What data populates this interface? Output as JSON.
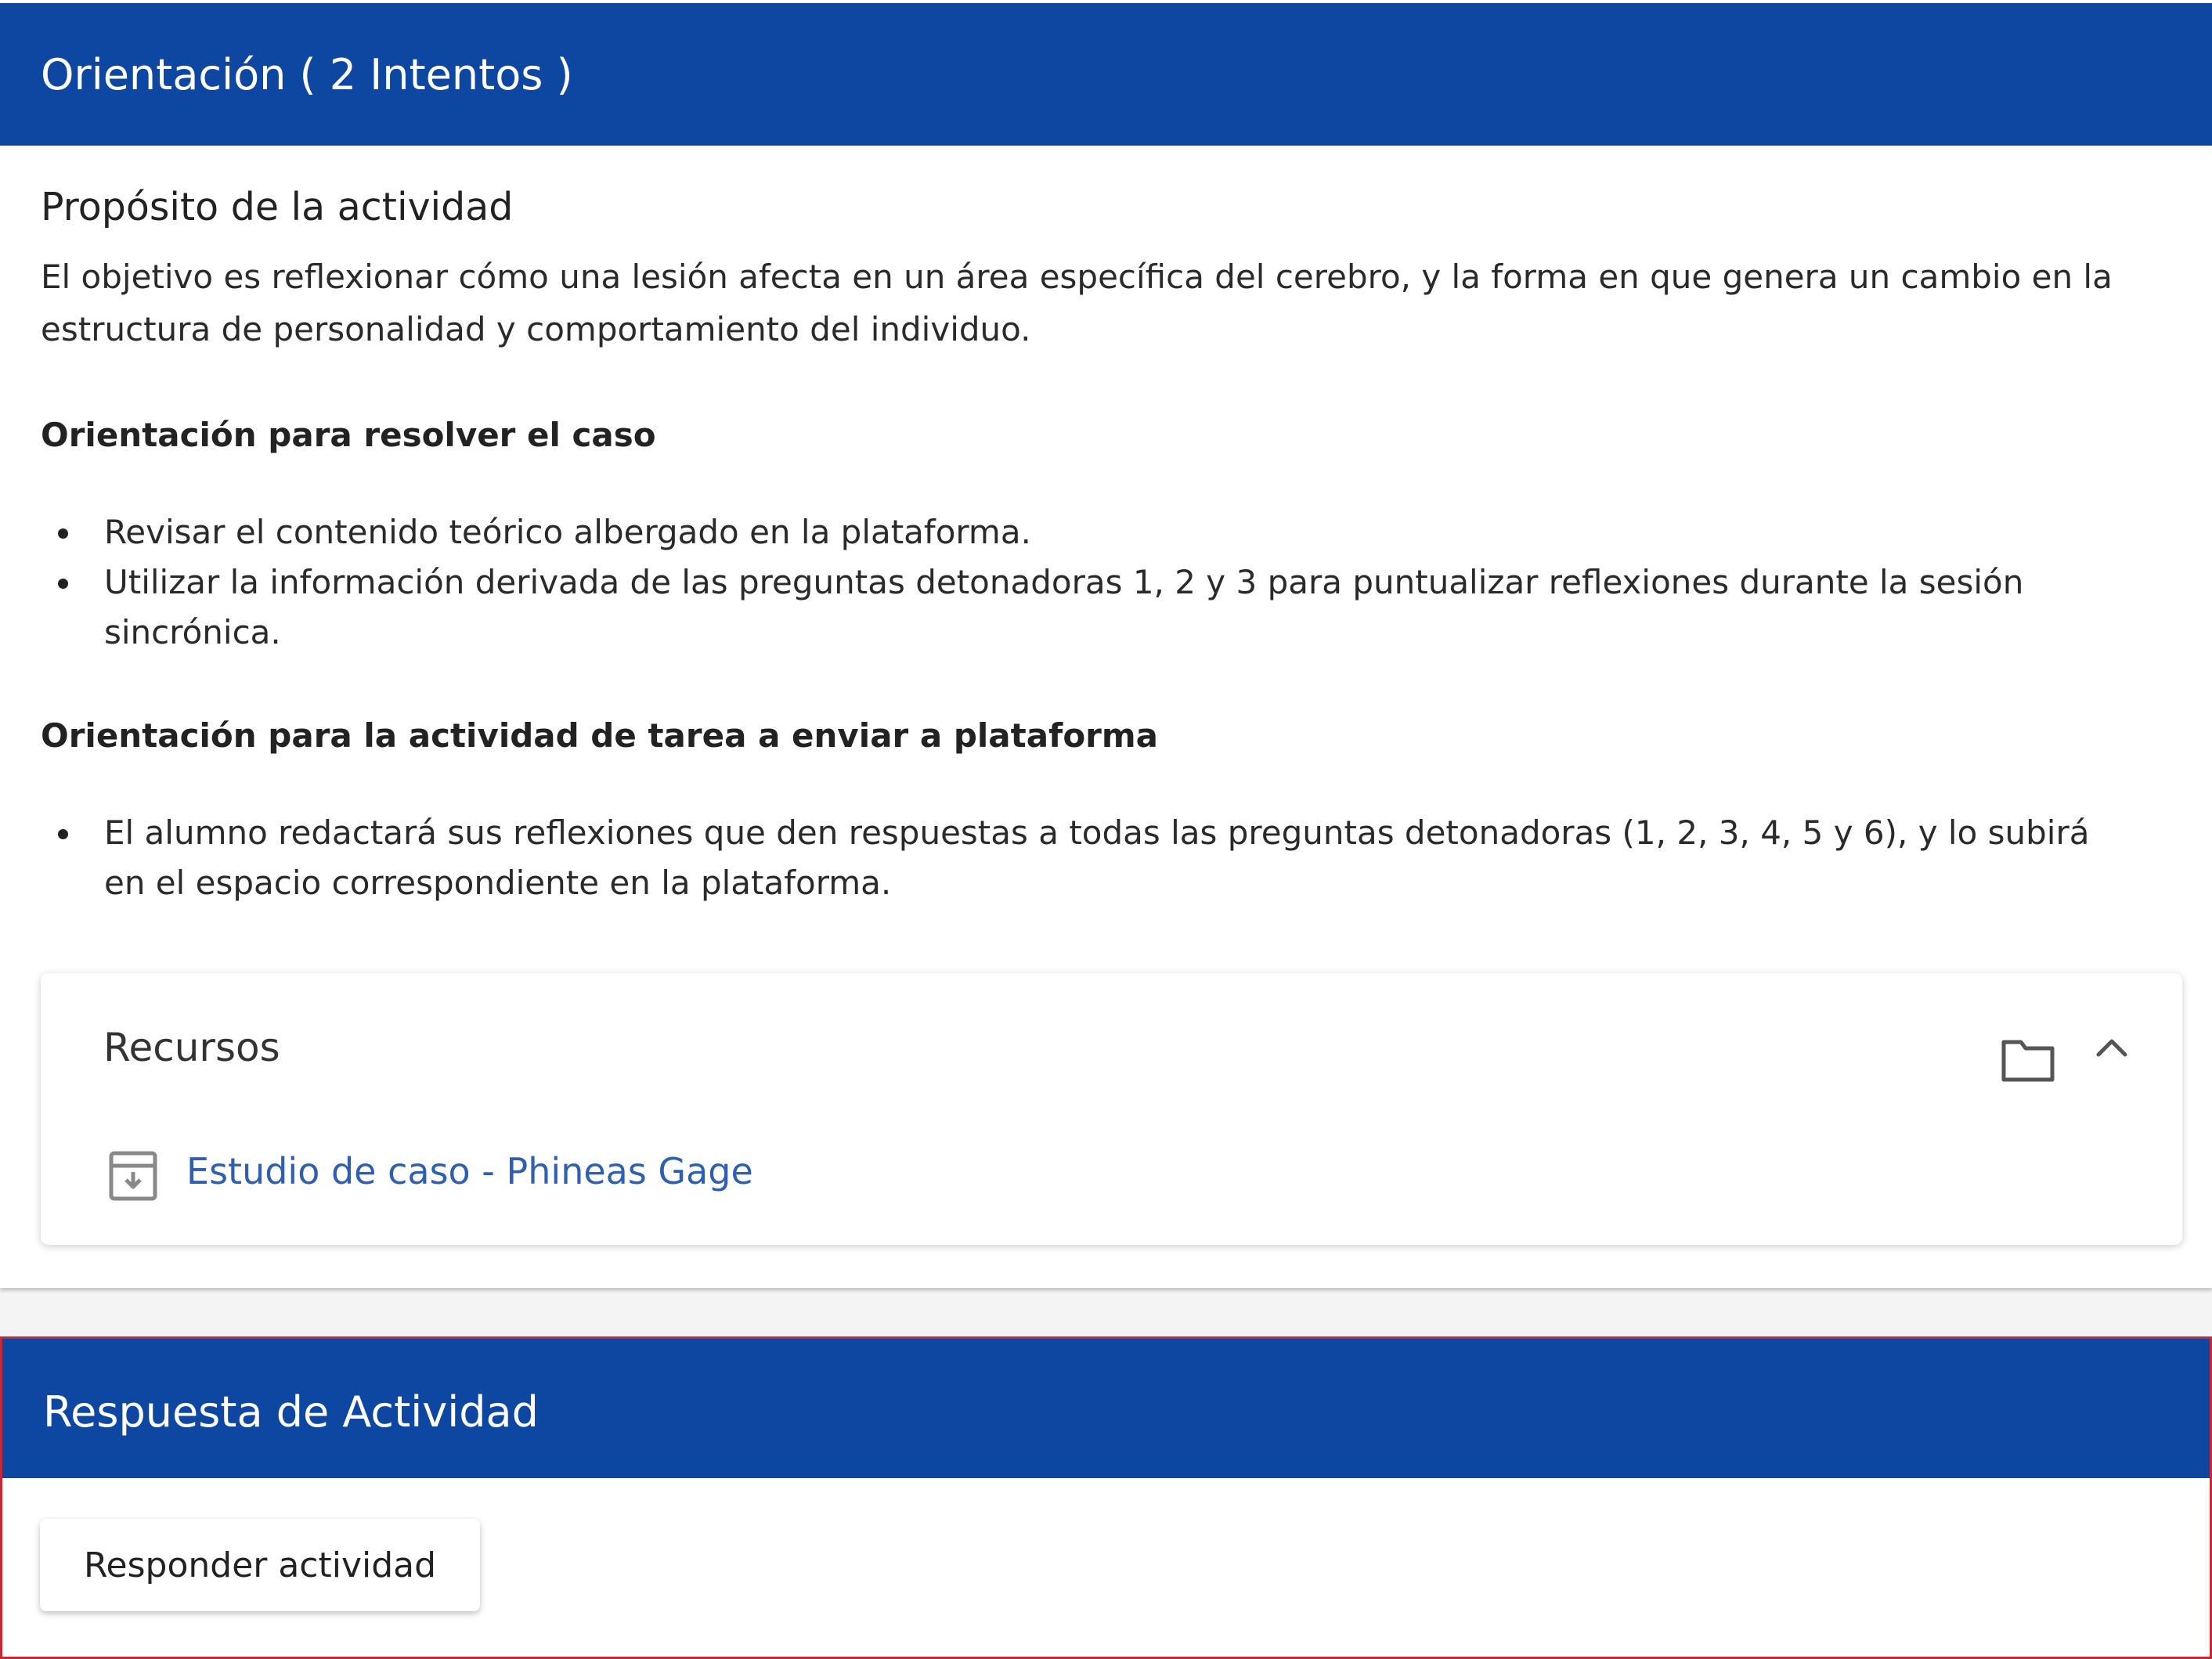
{
  "colors": {
    "header_bg": "#0d47a1",
    "header_text": "#ffffff",
    "link": "#2f5fb3",
    "focus_border": "#c62838"
  },
  "orientation_card": {
    "title": "Orientación ( 2 Intentos )",
    "purpose": {
      "title": "Propósito de la actividad",
      "text": "El objetivo es reflexionar cómo una lesión afecta en un área específica del cerebro, y la forma en que genera un cambio en la estructura de personalidad y comportamiento del individuo."
    },
    "case_section": {
      "title": "Orientación para resolver el caso",
      "items": [
        "Revisar el contenido teórico albergado en la plataforma.",
        "Utilizar la información derivada de las preguntas detonadoras 1, 2 y 3 para puntualizar reflexiones durante la sesión sincrónica."
      ]
    },
    "homework_section": {
      "title": "Orientación para la actividad de tarea a enviar a plataforma",
      "items": [
        "El alumno redactará sus reflexiones que den respuestas a todas las preguntas detonadoras (1, 2, 3, 4, 5 y 6), y lo subirá en el espacio correspondiente en la plataforma."
      ]
    },
    "resources": {
      "title": "Recursos",
      "folder_icon": "folder-icon",
      "toggle_icon": "chevron-up-icon",
      "items": [
        {
          "icon": "download-file-icon",
          "label": "Estudio de caso - Phineas Gage"
        }
      ]
    }
  },
  "response_card": {
    "title": "Respuesta de Actividad",
    "button_label": "Responder actividad"
  }
}
